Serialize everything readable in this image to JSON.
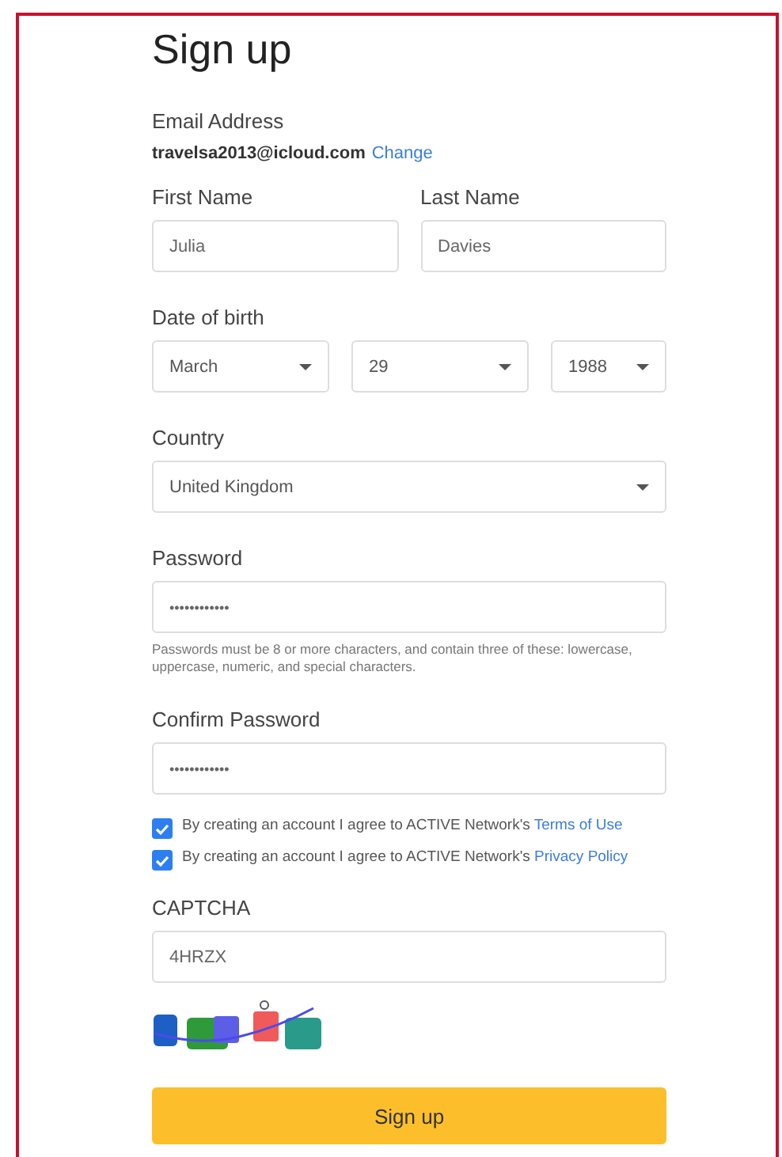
{
  "title": "Sign up",
  "email": {
    "label": "Email Address",
    "value": "travelsa2013@icloud.com",
    "change_link": "Change"
  },
  "first_name": {
    "label": "First Name",
    "value": "Julia"
  },
  "last_name": {
    "label": "Last Name",
    "value": "Davies"
  },
  "date_of_birth": {
    "label": "Date of birth",
    "month": "March",
    "day": "29",
    "year": "1988"
  },
  "country": {
    "label": "Country",
    "value": "United Kingdom"
  },
  "password": {
    "label": "Password",
    "value": "••••••••••••",
    "hint": "Passwords must be 8 or more characters, and contain three of these: lowercase, uppercase, numeric, and special characters."
  },
  "confirm_password": {
    "label": "Confirm Password",
    "value": "••••••••••••"
  },
  "agreements": [
    {
      "text": "By creating an account I agree to ACTIVE Network's",
      "link": "Terms of Use",
      "checked": true
    },
    {
      "text": "By creating an account I agree to ACTIVE Network's",
      "link": "Privacy Policy",
      "checked": true
    }
  ],
  "captcha": {
    "label": "CAPTCHA",
    "value": "4HRZX"
  },
  "submit_button": "Sign up"
}
